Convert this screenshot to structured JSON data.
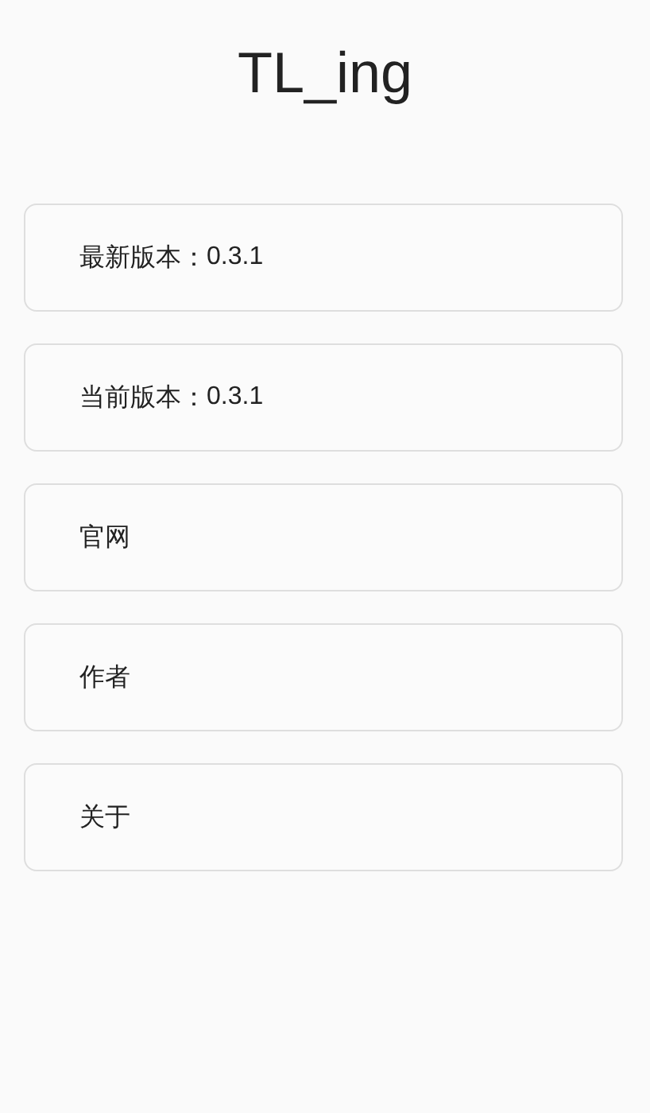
{
  "title": "TL_ing",
  "items": [
    {
      "label": "最新版本：",
      "value": "0.3.1"
    },
    {
      "label": "当前版本：",
      "value": "0.3.1"
    },
    {
      "label": "官网"
    },
    {
      "label": "作者"
    },
    {
      "label": "关于"
    }
  ]
}
